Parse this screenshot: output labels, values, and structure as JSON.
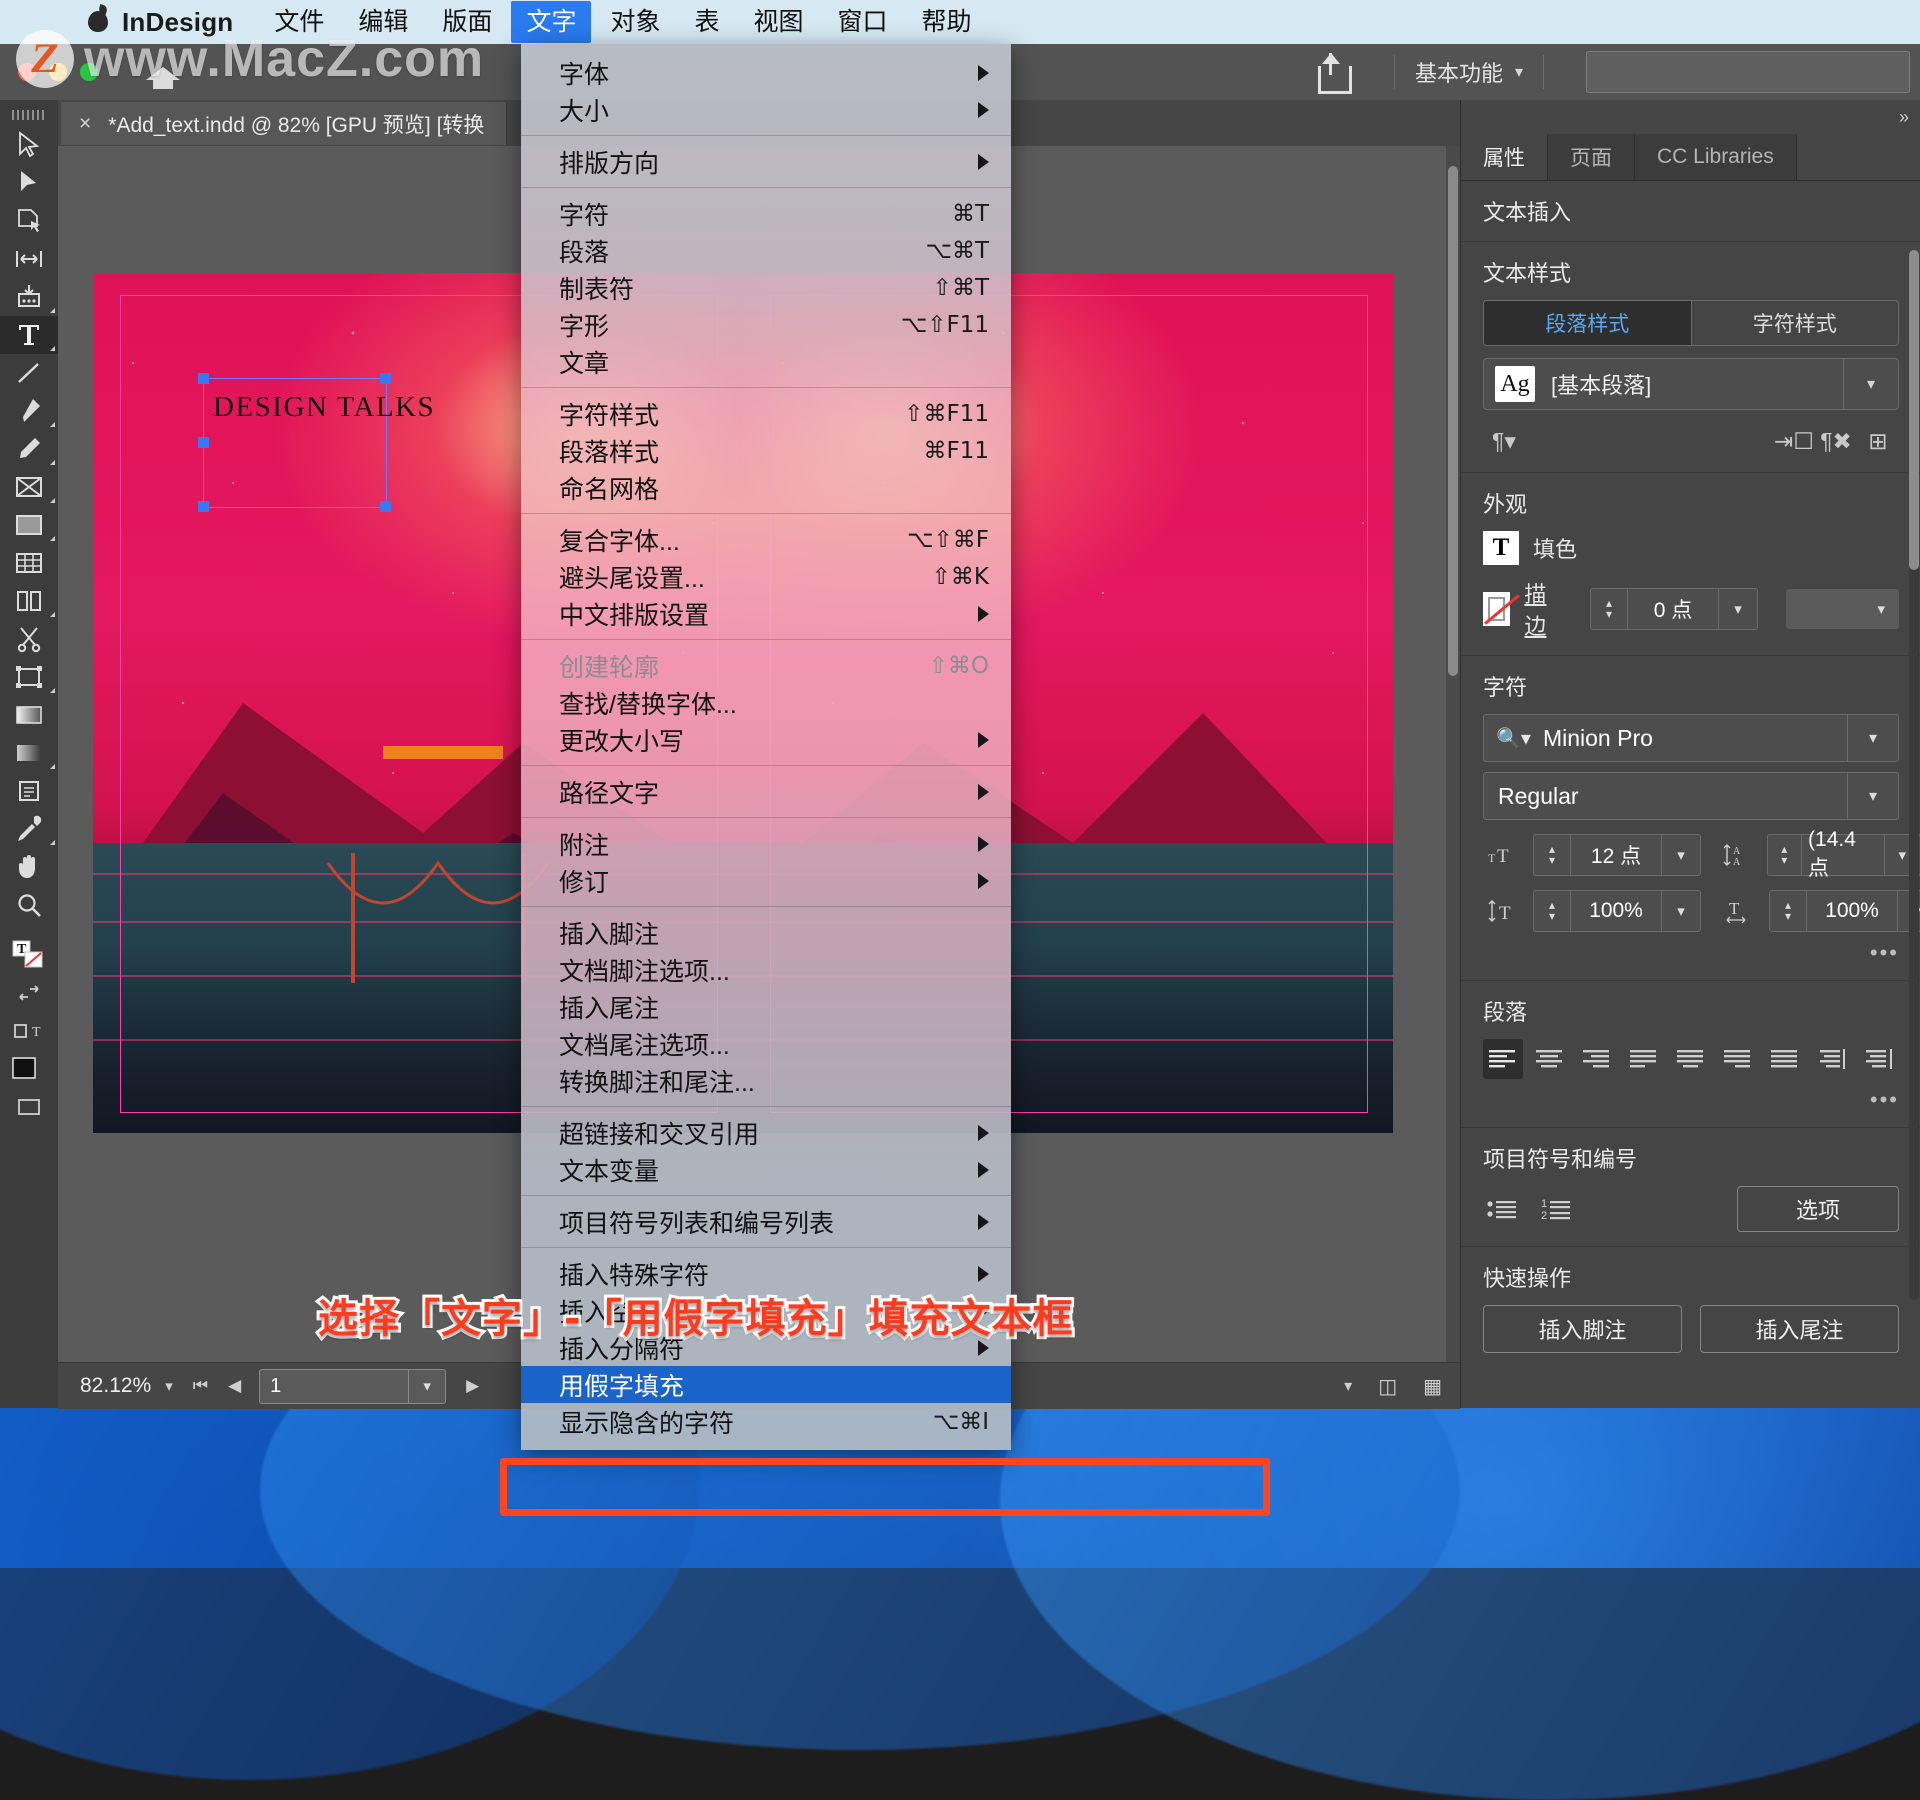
{
  "watermark": {
    "badge": "Z",
    "text": "www.MacZ.com"
  },
  "menubar": {
    "app_name": "InDesign",
    "items": [
      {
        "label": "文件",
        "active": false
      },
      {
        "label": "编辑",
        "active": false
      },
      {
        "label": "版面",
        "active": false
      },
      {
        "label": "文字",
        "active": true
      },
      {
        "label": "对象",
        "active": false
      },
      {
        "label": "表",
        "active": false
      },
      {
        "label": "视图",
        "active": false
      },
      {
        "label": "窗口",
        "active": false
      },
      {
        "label": "帮助",
        "active": false
      }
    ]
  },
  "chrome": {
    "workspace": "基本功能",
    "share_icon": "share-icon",
    "home_icon": "home-icon"
  },
  "document_tab": {
    "close": "×",
    "title": "*Add_text.indd @ 82% [GPU 预览] [转换"
  },
  "tools": [
    {
      "name": "selection-tool",
      "selected": false
    },
    {
      "name": "direct-selection-tool",
      "selected": false
    },
    {
      "name": "page-tool",
      "selected": false
    },
    {
      "name": "gap-tool",
      "selected": false
    },
    {
      "name": "content-collector-tool",
      "selected": false
    },
    {
      "name": "type-tool",
      "selected": true
    },
    {
      "name": "line-tool",
      "selected": false
    },
    {
      "name": "pen-tool",
      "selected": false
    },
    {
      "name": "pencil-tool",
      "selected": false
    },
    {
      "name": "frame-tool",
      "selected": false
    },
    {
      "name": "rectangle-tool",
      "selected": false
    },
    {
      "name": "table-tool",
      "selected": false
    },
    {
      "name": "grid-tool",
      "selected": false
    },
    {
      "name": "scissors-tool",
      "selected": false
    },
    {
      "name": "free-transform-tool",
      "selected": false
    },
    {
      "name": "gradient-swatch-tool",
      "selected": false
    },
    {
      "name": "gradient-feather-tool",
      "selected": false
    },
    {
      "name": "note-tool",
      "selected": false
    },
    {
      "name": "eyedropper-tool",
      "selected": false
    },
    {
      "name": "hand-tool",
      "selected": false
    },
    {
      "name": "zoom-tool",
      "selected": false
    }
  ],
  "canvas": {
    "headline": "DESIGN TALKS"
  },
  "status": {
    "zoom": "82.12%",
    "page": "1"
  },
  "menu": {
    "groups": [
      [
        {
          "label": "字体",
          "shortcut": "",
          "submenu": true,
          "disabled": false,
          "highlighted": false
        },
        {
          "label": "大小",
          "shortcut": "",
          "submenu": true,
          "disabled": false,
          "highlighted": false
        }
      ],
      [
        {
          "label": "排版方向",
          "shortcut": "",
          "submenu": true,
          "disabled": false,
          "highlighted": false
        }
      ],
      [
        {
          "label": "字符",
          "shortcut": "⌘T",
          "submenu": false,
          "disabled": false,
          "highlighted": false
        },
        {
          "label": "段落",
          "shortcut": "⌥⌘T",
          "submenu": false,
          "disabled": false,
          "highlighted": false
        },
        {
          "label": "制表符",
          "shortcut": "⇧⌘T",
          "submenu": false,
          "disabled": false,
          "highlighted": false
        },
        {
          "label": "字形",
          "shortcut": "⌥⇧F11",
          "submenu": false,
          "disabled": false,
          "highlighted": false
        },
        {
          "label": "文章",
          "shortcut": "",
          "submenu": false,
          "disabled": false,
          "highlighted": false
        }
      ],
      [
        {
          "label": "字符样式",
          "shortcut": "⇧⌘F11",
          "submenu": false,
          "disabled": false,
          "highlighted": false
        },
        {
          "label": "段落样式",
          "shortcut": "⌘F11",
          "submenu": false,
          "disabled": false,
          "highlighted": false
        },
        {
          "label": "命名网格",
          "shortcut": "",
          "submenu": false,
          "disabled": false,
          "highlighted": false
        }
      ],
      [
        {
          "label": "复合字体...",
          "shortcut": "⌥⇧⌘F",
          "submenu": false,
          "disabled": false,
          "highlighted": false
        },
        {
          "label": "避头尾设置...",
          "shortcut": "⇧⌘K",
          "submenu": false,
          "disabled": false,
          "highlighted": false
        },
        {
          "label": "中文排版设置",
          "shortcut": "",
          "submenu": true,
          "disabled": false,
          "highlighted": false
        }
      ],
      [
        {
          "label": "创建轮廓",
          "shortcut": "⇧⌘O",
          "submenu": false,
          "disabled": true,
          "highlighted": false
        },
        {
          "label": "查找/替换字体...",
          "shortcut": "",
          "submenu": false,
          "disabled": false,
          "highlighted": false
        },
        {
          "label": "更改大小写",
          "shortcut": "",
          "submenu": true,
          "disabled": false,
          "highlighted": false
        }
      ],
      [
        {
          "label": "路径文字",
          "shortcut": "",
          "submenu": true,
          "disabled": false,
          "highlighted": false
        }
      ],
      [
        {
          "label": "附注",
          "shortcut": "",
          "submenu": true,
          "disabled": false,
          "highlighted": false
        },
        {
          "label": "修订",
          "shortcut": "",
          "submenu": true,
          "disabled": false,
          "highlighted": false
        }
      ],
      [
        {
          "label": "插入脚注",
          "shortcut": "",
          "submenu": false,
          "disabled": false,
          "highlighted": false
        },
        {
          "label": "文档脚注选项...",
          "shortcut": "",
          "submenu": false,
          "disabled": false,
          "highlighted": false
        },
        {
          "label": "插入尾注",
          "shortcut": "",
          "submenu": false,
          "disabled": false,
          "highlighted": false
        },
        {
          "label": "文档尾注选项...",
          "shortcut": "",
          "submenu": false,
          "disabled": false,
          "highlighted": false
        },
        {
          "label": "转换脚注和尾注...",
          "shortcut": "",
          "submenu": false,
          "disabled": false,
          "highlighted": false
        }
      ],
      [
        {
          "label": "超链接和交叉引用",
          "shortcut": "",
          "submenu": true,
          "disabled": false,
          "highlighted": false
        },
        {
          "label": "文本变量",
          "shortcut": "",
          "submenu": true,
          "disabled": false,
          "highlighted": false
        }
      ],
      [
        {
          "label": "项目符号列表和编号列表",
          "shortcut": "",
          "submenu": true,
          "disabled": false,
          "highlighted": false
        }
      ],
      [
        {
          "label": "插入特殊字符",
          "shortcut": "",
          "submenu": true,
          "disabled": false,
          "highlighted": false
        },
        {
          "label": "插入空格",
          "shortcut": "",
          "submenu": true,
          "disabled": false,
          "highlighted": false
        },
        {
          "label": "插入分隔符",
          "shortcut": "",
          "submenu": true,
          "disabled": false,
          "highlighted": false
        },
        {
          "label": "用假字填充",
          "shortcut": "",
          "submenu": false,
          "disabled": false,
          "highlighted": true
        },
        {
          "label": "显示隐含的字符",
          "shortcut": "⌥⌘I",
          "submenu": false,
          "disabled": false,
          "highlighted": false
        }
      ]
    ]
  },
  "properties_panel": {
    "tabs": [
      {
        "label": "属性",
        "active": true
      },
      {
        "label": "页面",
        "active": false
      },
      {
        "label": "CC Libraries",
        "active": false
      }
    ],
    "text_insert_header": "文本插入",
    "text_style": {
      "header": "文本样式",
      "segments": [
        {
          "label": "段落样式",
          "active": true
        },
        {
          "label": "字符样式",
          "active": false
        }
      ],
      "style_icon": "Ag",
      "style_value": "[基本段落]",
      "icons": [
        "paragraph-style-icon",
        "redefine-style-icon",
        "clear-overrides-icon",
        "new-style-icon"
      ]
    },
    "appearance": {
      "header": "外观",
      "fill_label": "填色",
      "fill_icon": "T",
      "stroke_label": "描边",
      "stroke_weight": "0 点",
      "stroke_type_value": ""
    },
    "character": {
      "header": "字符",
      "font_family": "Minion Pro",
      "font_style": "Regular",
      "font_size": "12 点",
      "leading": "(14.4 点",
      "vertical_scale": "100%",
      "horizontal_scale": "100%",
      "more_label": "•••"
    },
    "paragraph": {
      "header": "段落",
      "align_icons": [
        "align-left-icon",
        "align-center-icon",
        "align-right-icon",
        "justify-last-left-icon",
        "justify-last-center-icon",
        "justify-last-right-icon",
        "justify-all-icon",
        "align-toward-spine-icon",
        "align-away-spine-icon"
      ],
      "active_align_index": 0,
      "more_label": "•••"
    },
    "bullets": {
      "header": "项目符号和编号",
      "bullet_icon": "bulleted-list-icon",
      "number_icon": "numbered-list-icon",
      "options_label": "选项"
    },
    "quick_actions": {
      "header": "快速操作",
      "buttons": [
        "插入脚注",
        "插入尾注"
      ]
    }
  },
  "annotation": {
    "text": "选择「文字」-「用假字填充」填充文本框",
    "color": "#ff3b1f"
  }
}
